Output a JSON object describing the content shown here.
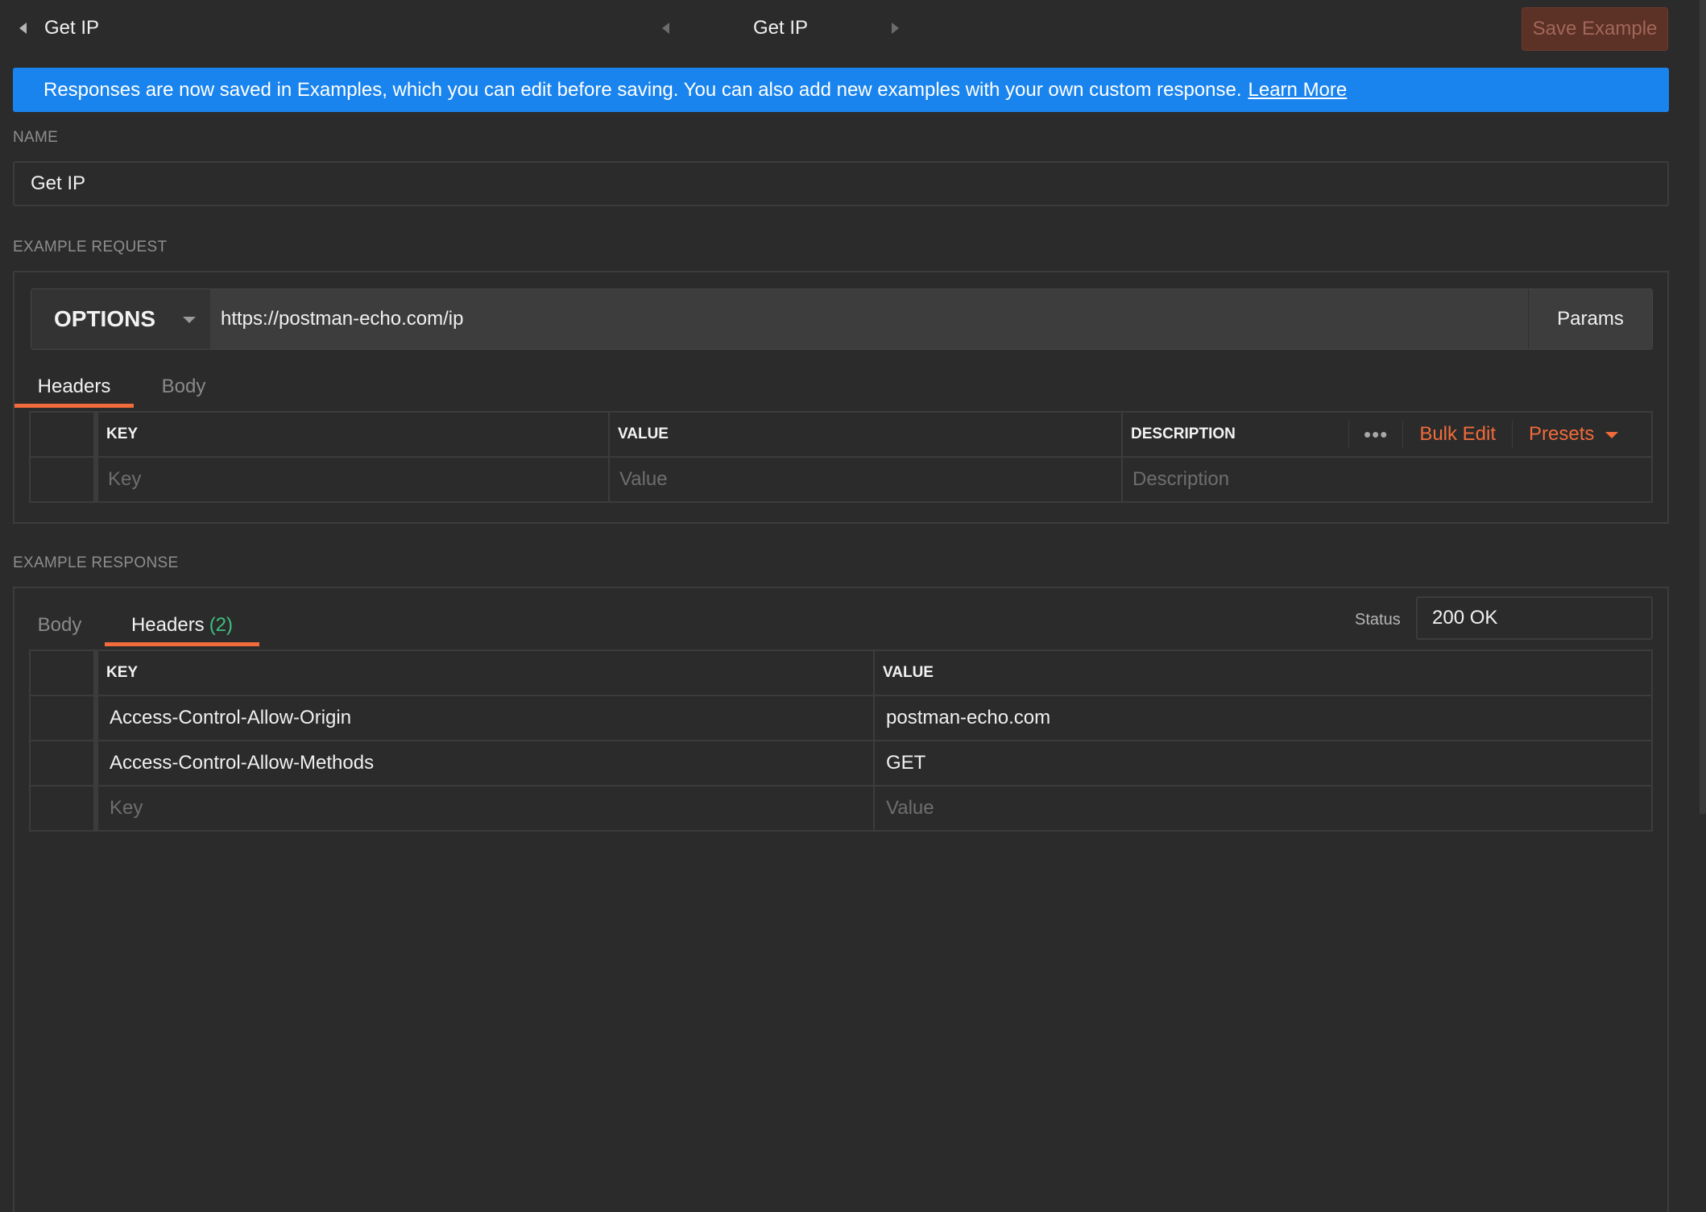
{
  "topbar": {
    "back_title": "Get IP",
    "center_title": "Get IP",
    "save_label": "Save Example"
  },
  "banner": {
    "text": "Responses are now saved in Examples, which you can edit before saving. You can also add new examples with your own custom response.",
    "link": "Learn More"
  },
  "name_section": {
    "label": "NAME",
    "value": "Get IP"
  },
  "request": {
    "label": "EXAMPLE REQUEST",
    "method": "OPTIONS",
    "url": "https://postman-echo.com/ip",
    "params_label": "Params",
    "tabs": [
      {
        "label": "Headers"
      },
      {
        "label": "Body"
      }
    ],
    "table": {
      "headers": {
        "key": "KEY",
        "value": "VALUE",
        "description": "DESCRIPTION"
      },
      "more_label": "•••",
      "bulk_edit": "Bulk Edit",
      "presets": "Presets",
      "placeholders": {
        "key": "Key",
        "value": "Value",
        "description": "Description"
      }
    }
  },
  "response": {
    "label": "EXAMPLE RESPONSE",
    "tabs": [
      {
        "label": "Body"
      },
      {
        "label": "Headers",
        "count": "(2)"
      }
    ],
    "status_label": "Status",
    "status_value": "200 OK",
    "table": {
      "headers": {
        "key": "KEY",
        "value": "VALUE"
      },
      "rows": [
        {
          "key": "Access-Control-Allow-Origin",
          "value": "postman-echo.com"
        },
        {
          "key": "Access-Control-Allow-Methods",
          "value": "GET"
        }
      ],
      "placeholders": {
        "key": "Key",
        "value": "Value"
      }
    }
  },
  "colors": {
    "background": "#2b2b2b",
    "accent": "#f26b3a",
    "banner": "#1a84ee",
    "count_green": "#3fbf7f"
  }
}
